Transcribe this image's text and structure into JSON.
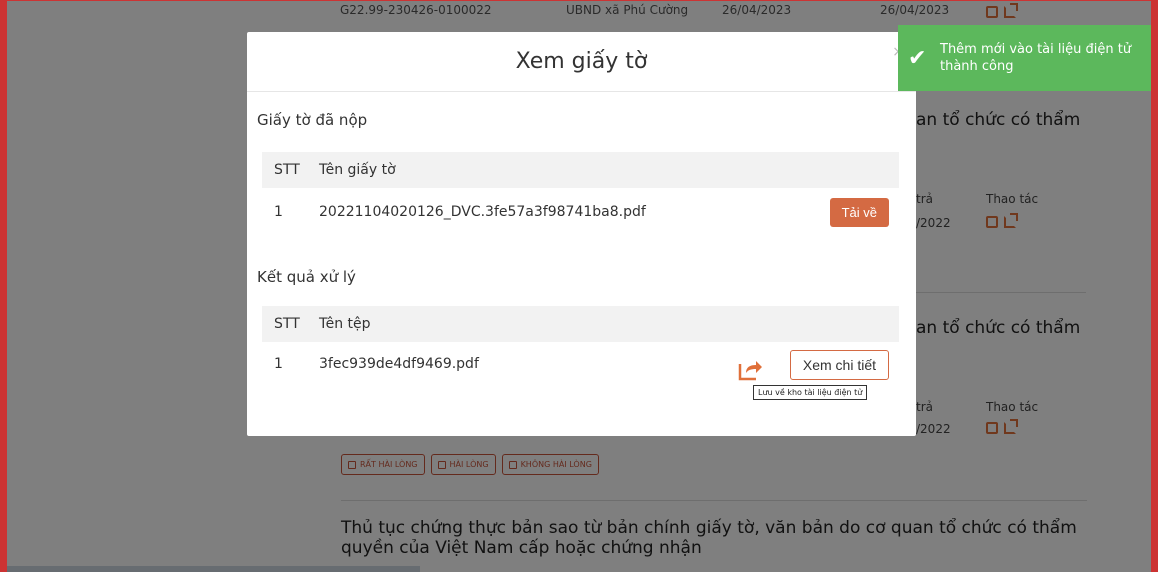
{
  "background": {
    "top_row": {
      "code": "G22.99-230426-0100022",
      "agency": "UBND xã Phú Cường",
      "date1": "26/04/2023",
      "date2": "26/04/2023"
    },
    "title_fragment_1": "an tổ chức có thẩm",
    "title_fragment_2": "an tổ chức có thẩm",
    "col_return": "trả",
    "col_actions": "Thao tác",
    "date_frag_1": "/2022",
    "date_frag_2": "/2022",
    "rating_buttons": [
      "RẤT HÀI LÒNG",
      "HÀI LÒNG",
      "KHÔNG HÀI LÒNG"
    ],
    "procedure_title": "Thủ tục chứng thực bản sao từ bản chính giấy tờ, văn bản do cơ quan tổ chức có thẩm quyền của Việt Nam cấp hoặc chứng nhận"
  },
  "modal": {
    "title": "Xem giấy tờ",
    "close": "×",
    "submitted": {
      "section_title": "Giấy tờ đã nộp",
      "headers": {
        "index": "STT",
        "name": "Tên giấy tờ"
      },
      "rows": [
        {
          "index": "1",
          "name": "20221104020126_DVC.3fe57a3f98741ba8.pdf",
          "action": "Tải về"
        }
      ]
    },
    "results": {
      "section_title": "Kết quả xử lý",
      "headers": {
        "index": "STT",
        "name": "Tên tệp"
      },
      "rows": [
        {
          "index": "1",
          "name": "3fec939de4df9469.pdf",
          "action": "Xem chi tiết"
        }
      ]
    },
    "tooltip": "Lưu về kho tài liệu điện tử"
  },
  "toast": {
    "message": "Thêm mới vào tài liệu điện tử thành công"
  },
  "colors": {
    "accent": "#d46a43",
    "toast": "#5cb85c"
  }
}
